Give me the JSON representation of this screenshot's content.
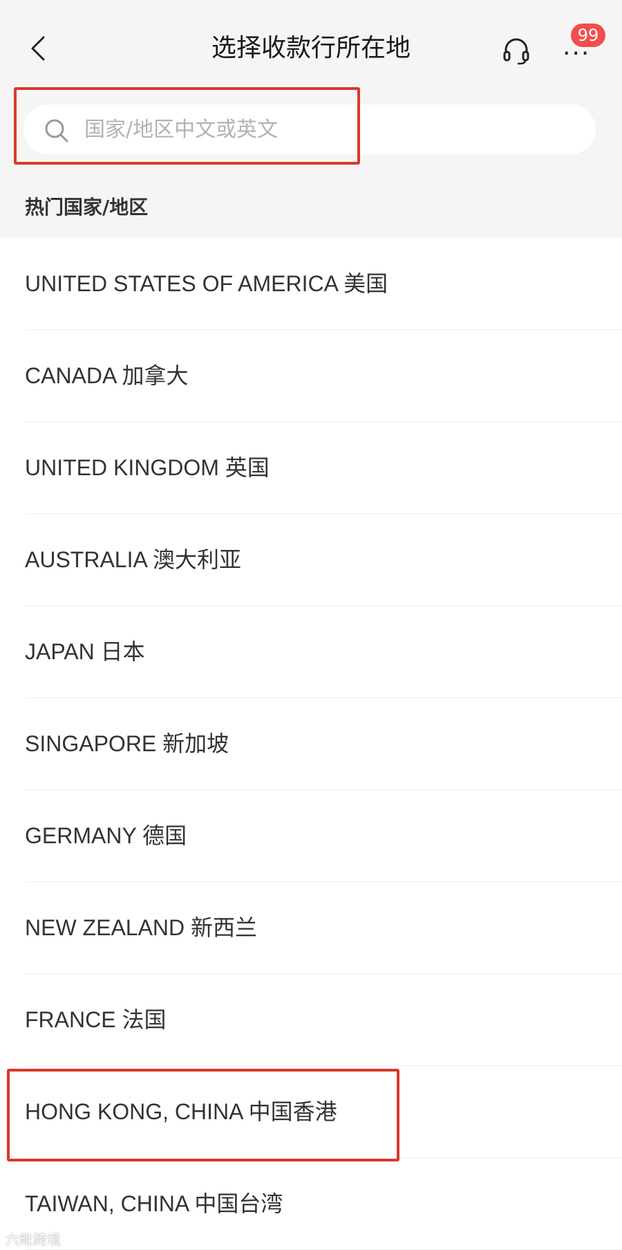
{
  "header": {
    "title": "选择收款行所在地",
    "badge_count": "99",
    "more_label": "···"
  },
  "search": {
    "placeholder": "国家/地区中文或英文",
    "value": ""
  },
  "section": {
    "title": "热门国家/地区"
  },
  "countries": [
    {
      "label": "UNITED STATES OF AMERICA 美国"
    },
    {
      "label": "CANADA 加拿大"
    },
    {
      "label": "UNITED KINGDOM 英国"
    },
    {
      "label": "AUSTRALIA 澳大利亚"
    },
    {
      "label": "JAPAN 日本"
    },
    {
      "label": "SINGAPORE 新加坡"
    },
    {
      "label": "GERMANY 德国"
    },
    {
      "label": "NEW ZEALAND 新西兰"
    },
    {
      "label": "FRANCE 法国"
    },
    {
      "label": "HONG KONG, CHINA 中国香港"
    },
    {
      "label": "TAIWAN, CHINA 中国台湾"
    }
  ],
  "watermark": {
    "text": "六毗跨境"
  },
  "colors": {
    "accent_badge": "#f24e4b",
    "highlight_box": "#d9382c",
    "header_bg": "#f5f5f5"
  }
}
